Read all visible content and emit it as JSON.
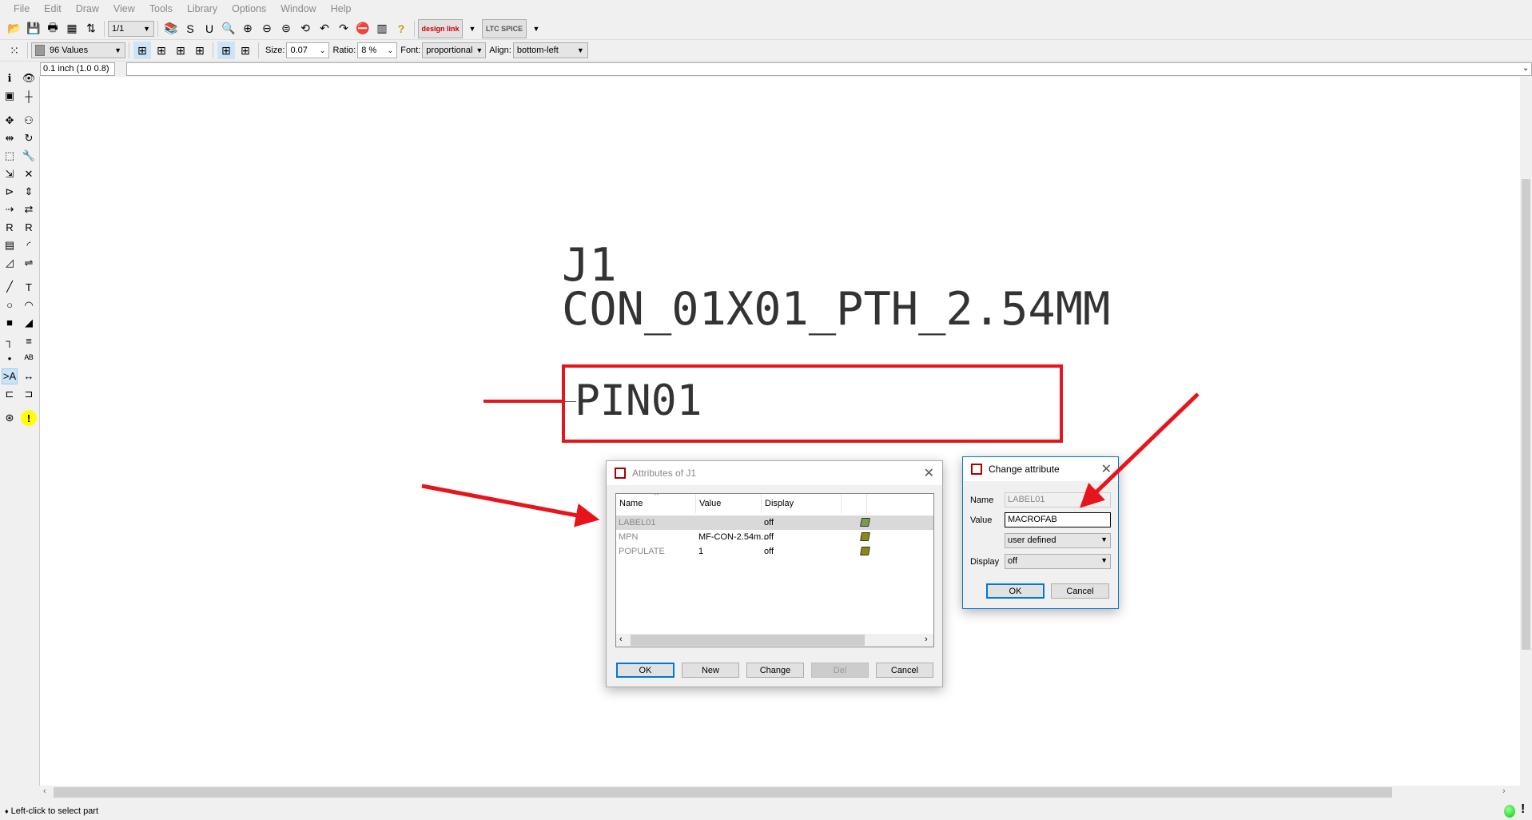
{
  "menu": [
    "File",
    "Edit",
    "Draw",
    "View",
    "Tools",
    "Library",
    "Options",
    "Window",
    "Help"
  ],
  "toolbar1": {
    "icons": [
      "open-icon",
      "save-icon",
      "print-icon",
      "cam-processor-icon",
      "switch-board-icon"
    ],
    "sheet": "1/1",
    "icons2": [
      "library-icon",
      "script-icon",
      "ulp-icon",
      "zoom-fit-icon",
      "zoom-in-icon",
      "zoom-out-icon",
      "zoom-select-icon",
      "zoom-redraw-icon",
      "undo-icon",
      "redo-icon",
      "stop-icon",
      "drc-icon",
      "help-icon"
    ],
    "design_link": "design link",
    "ltspice": "LTC SPICE"
  },
  "toolbar2": {
    "layer": "96 Values",
    "size_label": "Size:",
    "size": "0.07",
    "ratio_label": "Ratio:",
    "ratio": "8 %",
    "font_label": "Font:",
    "font": "proportional",
    "align_label": "Align:",
    "align": "bottom-left"
  },
  "coord": "0.1 inch (1.0 0.8)",
  "left_tools": [
    "info",
    "show",
    "display-layers",
    "mark",
    "move",
    "copy",
    "mirror",
    "rotate",
    "group",
    "change",
    "paste",
    "delete",
    "add",
    "replace",
    "invoke",
    "gate-swap",
    "name",
    "value",
    "smash",
    "miter",
    "split",
    "optimize",
    "wire",
    "text",
    "circle",
    "arc",
    "rectangle",
    "polygon",
    "net",
    "bus",
    "junction",
    "label",
    "attribute",
    "dimension",
    "frame",
    "pin",
    "errc",
    "erc-warning"
  ],
  "canvas": {
    "name": "J1",
    "value": "CON_01X01_PTH_2.54MM",
    "pin": "PIN01",
    "highlight": "#e8141b"
  },
  "attr_dialog": {
    "title": "Attributes of J1",
    "columns": [
      "Name",
      "Value",
      "Display"
    ],
    "rows": [
      {
        "name": "LABEL01",
        "value": "",
        "display": "off"
      },
      {
        "name": "MPN",
        "value": "MF-CON-2.54m...",
        "display": "off"
      },
      {
        "name": "POPULATE",
        "value": "1",
        "display": "off"
      }
    ],
    "buttons": {
      "ok": "OK",
      "new": "New",
      "change": "Change",
      "del": "Del",
      "cancel": "Cancel"
    }
  },
  "change_dialog": {
    "title": "Change attribute",
    "name_label": "Name",
    "name": "LABEL01",
    "value_label": "Value",
    "value": "MACROFAB",
    "type": "user defined",
    "display_label": "Display",
    "display": "off",
    "ok": "OK",
    "cancel": "Cancel"
  },
  "status": "Left-click to select part"
}
